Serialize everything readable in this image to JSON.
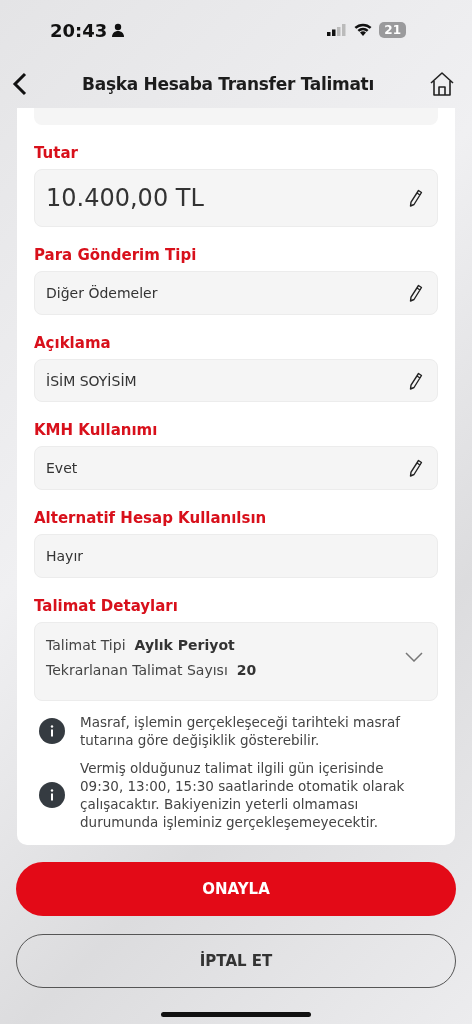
{
  "status_bar": {
    "time": "20:43"
  },
  "header": {
    "title": "Başka Hesaba Transfer Talimatı"
  },
  "fields": [
    {
      "label": "Tutar",
      "value": "10.400,00 TL",
      "kind": "amount",
      "editable": true
    },
    {
      "label": "Para Gönderim Tipi",
      "value": "Diğer Ödemeler",
      "kind": "text",
      "editable": true
    },
    {
      "label": "Açıklama",
      "value": "İSİM SOYİSİM",
      "kind": "text",
      "editable": true
    },
    {
      "label": "KMH Kullanımı",
      "value": "Evet",
      "kind": "text",
      "editable": true
    },
    {
      "label": "Alternatif Hesap Kullanılsın",
      "value": "Hayır",
      "kind": "text",
      "editable": false
    }
  ],
  "details": {
    "label": "Talimat Detayları",
    "expanded": false,
    "rows": [
      {
        "name": "Talimat Tipi",
        "value": "Aylık Periyot"
      },
      {
        "name": "Tekrarlanan Talimat Sayısı",
        "value": "20"
      }
    ]
  },
  "notes": [
    "Masraf, işlemin gerçekleşeceği tarihteki masraf tutarına göre değişiklik gösterebilir.",
    "Vermiş olduğunuz talimat ilgili gün içerisinde 09:30, 13:00, 15:30 saatlarinde otomatik olarak çalışacaktır. Bakiyenizin yeterli olmaması durumunda işleminiz gerçekleşemeyecektir."
  ],
  "buttons": [
    {
      "label": "ONAYLA",
      "kind": "primary"
    },
    {
      "label": "İPTAL ET",
      "kind": "secondary"
    }
  ],
  "battery": {
    "text": "21"
  }
}
